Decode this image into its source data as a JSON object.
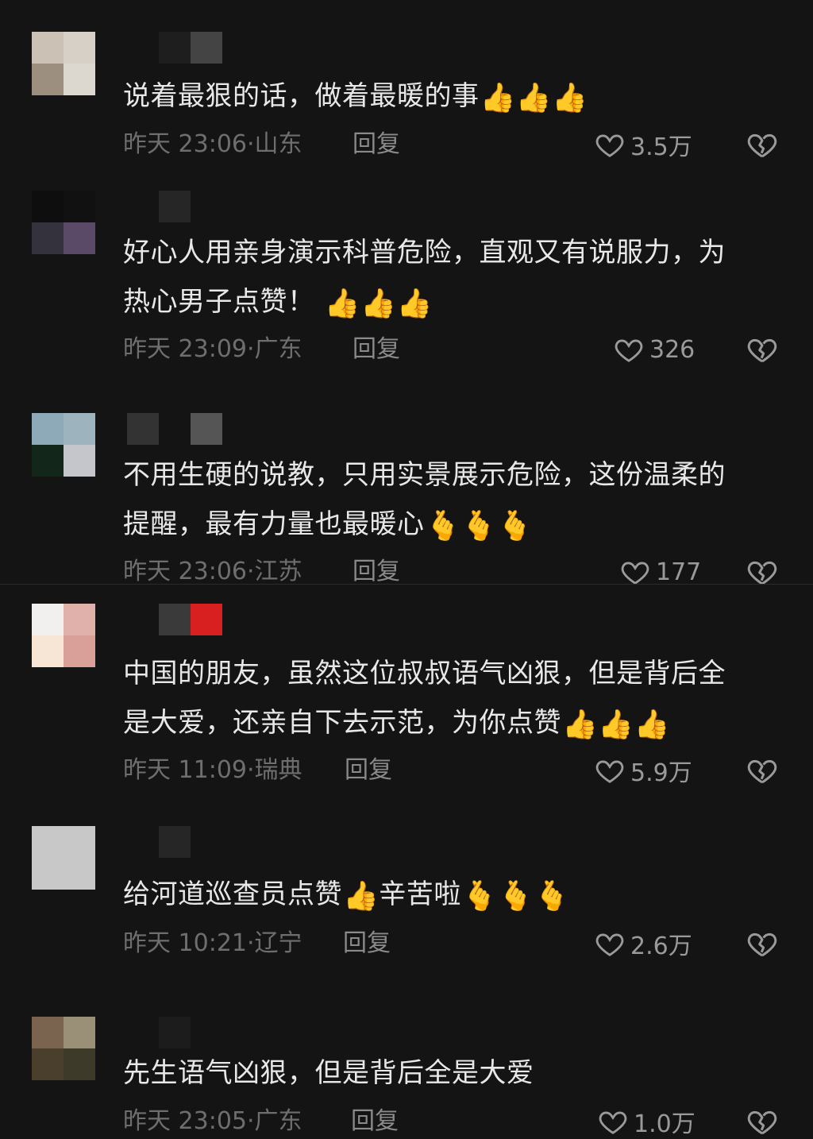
{
  "comments": [
    {
      "text_lines": [
        "说着最狠的话，做着最暖的事"
      ],
      "emoji_after": "👍👍👍",
      "time": "昨天 23:06",
      "location": "山东",
      "reply_label": "回复",
      "likes": "3.5万"
    },
    {
      "text_lines": [
        "好心人用亲身演示科普危险，直观又有说服力，为",
        "热心男子点赞！"
      ],
      "emoji_after": "👍👍👍",
      "time": "昨天 23:09",
      "location": "广东",
      "reply_label": "回复",
      "likes": "326"
    },
    {
      "text_lines": [
        "不用生硬的说教，只用实景展示危险，这份温柔的",
        "提醒，最有力量也最暖心"
      ],
      "emoji_after": "🫰🫰🫰",
      "time": "昨天 23:06",
      "location": "江苏",
      "reply_label": "回复",
      "likes": "177"
    },
    {
      "text_lines": [
        "中国的朋友，虽然这位叔叔语气凶狠，但是背后全",
        "是大爱，还亲自下去示范，为你点赞"
      ],
      "emoji_after": "👍👍👍",
      "time": "昨天 11:09",
      "location": "瑞典",
      "reply_label": "回复",
      "likes": "5.9万"
    },
    {
      "text_lines": [
        "给河道巡查员点赞"
      ],
      "emoji_mid": "👍",
      "text_tail": "辛苦啦",
      "emoji_after": "🫰🫰🫰",
      "time": "昨天 10:21",
      "location": "辽宁",
      "reply_label": "回复",
      "likes": "2.6万"
    },
    {
      "text_lines": [
        "先生语气凶狠，但是背后全是大爱"
      ],
      "emoji_after": "",
      "time": "昨天 23:05",
      "location": "广东",
      "reply_label": "回复",
      "likes": "1.0万"
    }
  ],
  "icons": {
    "like": "heart-outline-icon",
    "dislike": "broken-heart-icon"
  },
  "colors": {
    "background": "#141414",
    "text": "#e8e8e8",
    "meta": "#6e6e6e"
  }
}
